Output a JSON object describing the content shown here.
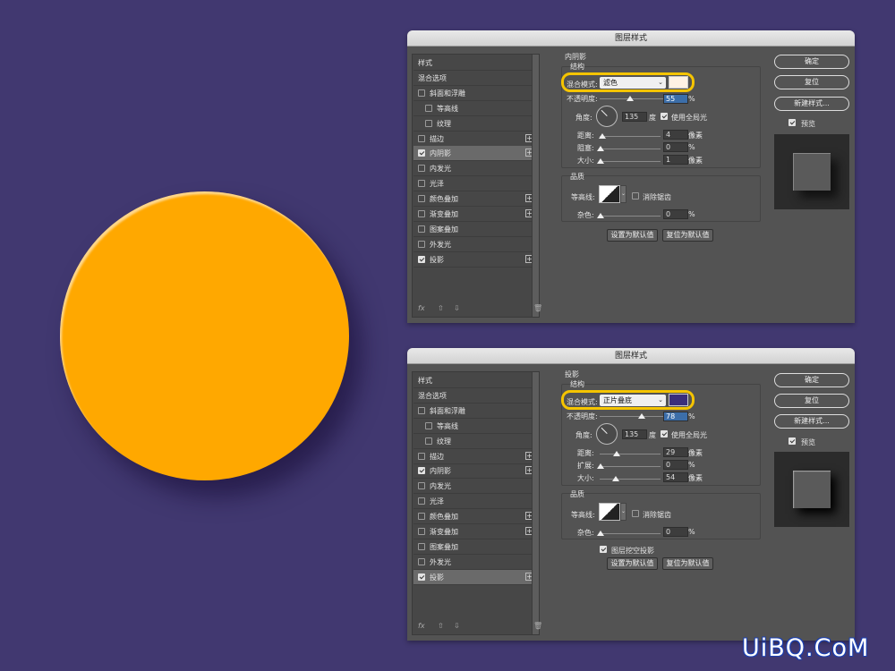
{
  "colors": {
    "background": "#413870",
    "orb": "#FFA800",
    "highlight": "#F5C400",
    "inner_shadow_swatch": "#FFF2E4",
    "drop_shadow_swatch": "#3B2E7A"
  },
  "dialogs": [
    {
      "title": "图层样式",
      "section": "内阴影",
      "structure_label": "结构",
      "blend_mode_label": "混合模式:",
      "blend_mode": "滤色",
      "opacity_label": "不透明度:",
      "opacity": "55",
      "angle_label": "角度:",
      "angle": "135",
      "angle_unit": "度",
      "global_light": "使用全局光",
      "distance_label": "距离:",
      "distance": "4",
      "param2_label": "阻塞:",
      "param2": "0",
      "param2_unit": "%",
      "size_label": "大小:",
      "size": "1",
      "px": "像素",
      "pct": "%",
      "quality_label": "品质",
      "contour_label": "等高线:",
      "antialias": "消除锯齿",
      "noise_label": "杂色:",
      "noise": "0",
      "knockout": "",
      "set_default": "设置为默认值",
      "reset_default": "复位为默认值",
      "ok": "确定",
      "reset": "复位",
      "new_style": "新建样式...",
      "preview": "预览",
      "fx": "fx",
      "styles": [
        {
          "label": "样式",
          "cb": false,
          "checked": false,
          "plus": false,
          "indent": 0
        },
        {
          "label": "混合选项",
          "cb": false,
          "checked": false,
          "plus": false,
          "indent": 0
        },
        {
          "label": "斜面和浮雕",
          "cb": true,
          "checked": false,
          "plus": false,
          "indent": 0
        },
        {
          "label": "等高线",
          "cb": true,
          "checked": false,
          "plus": false,
          "indent": 1
        },
        {
          "label": "纹理",
          "cb": true,
          "checked": false,
          "plus": false,
          "indent": 1
        },
        {
          "label": "描边",
          "cb": true,
          "checked": false,
          "plus": true,
          "indent": 0
        },
        {
          "label": "内阴影",
          "cb": true,
          "checked": true,
          "plus": true,
          "indent": 0,
          "active": true
        },
        {
          "label": "内发光",
          "cb": true,
          "checked": false,
          "plus": false,
          "indent": 0
        },
        {
          "label": "光泽",
          "cb": true,
          "checked": false,
          "plus": false,
          "indent": 0
        },
        {
          "label": "颜色叠加",
          "cb": true,
          "checked": false,
          "plus": true,
          "indent": 0
        },
        {
          "label": "渐变叠加",
          "cb": true,
          "checked": false,
          "plus": true,
          "indent": 0
        },
        {
          "label": "图案叠加",
          "cb": true,
          "checked": false,
          "plus": false,
          "indent": 0
        },
        {
          "label": "外发光",
          "cb": true,
          "checked": false,
          "plus": false,
          "indent": 0
        },
        {
          "label": "投影",
          "cb": true,
          "checked": true,
          "plus": true,
          "indent": 0
        }
      ]
    },
    {
      "title": "图层样式",
      "section": "投影",
      "structure_label": "结构",
      "blend_mode_label": "混合模式:",
      "blend_mode": "正片叠底",
      "opacity_label": "不透明度:",
      "opacity": "78",
      "angle_label": "角度:",
      "angle": "135",
      "angle_unit": "度",
      "global_light": "使用全局光",
      "distance_label": "距离:",
      "distance": "29",
      "param2_label": "扩展:",
      "param2": "0",
      "param2_unit": "%",
      "size_label": "大小:",
      "size": "54",
      "px": "像素",
      "pct": "%",
      "quality_label": "品质",
      "contour_label": "等高线:",
      "antialias": "消除锯齿",
      "noise_label": "杂色:",
      "noise": "0",
      "knockout": "图层挖空投影",
      "set_default": "设置为默认值",
      "reset_default": "复位为默认值",
      "ok": "确定",
      "reset": "复位",
      "new_style": "新建样式...",
      "preview": "预览",
      "fx": "fx",
      "styles": [
        {
          "label": "样式",
          "cb": false,
          "checked": false,
          "plus": false,
          "indent": 0
        },
        {
          "label": "混合选项",
          "cb": false,
          "checked": false,
          "plus": false,
          "indent": 0
        },
        {
          "label": "斜面和浮雕",
          "cb": true,
          "checked": false,
          "plus": false,
          "indent": 0
        },
        {
          "label": "等高线",
          "cb": true,
          "checked": false,
          "plus": false,
          "indent": 1
        },
        {
          "label": "纹理",
          "cb": true,
          "checked": false,
          "plus": false,
          "indent": 1
        },
        {
          "label": "描边",
          "cb": true,
          "checked": false,
          "plus": true,
          "indent": 0
        },
        {
          "label": "内阴影",
          "cb": true,
          "checked": true,
          "plus": true,
          "indent": 0
        },
        {
          "label": "内发光",
          "cb": true,
          "checked": false,
          "plus": false,
          "indent": 0
        },
        {
          "label": "光泽",
          "cb": true,
          "checked": false,
          "plus": false,
          "indent": 0
        },
        {
          "label": "颜色叠加",
          "cb": true,
          "checked": false,
          "plus": true,
          "indent": 0
        },
        {
          "label": "渐变叠加",
          "cb": true,
          "checked": false,
          "plus": true,
          "indent": 0
        },
        {
          "label": "图案叠加",
          "cb": true,
          "checked": false,
          "plus": false,
          "indent": 0
        },
        {
          "label": "外发光",
          "cb": true,
          "checked": false,
          "plus": false,
          "indent": 0
        },
        {
          "label": "投影",
          "cb": true,
          "checked": true,
          "plus": true,
          "indent": 0,
          "active": true
        }
      ]
    }
  ],
  "watermark": "UiBQ.CoM"
}
